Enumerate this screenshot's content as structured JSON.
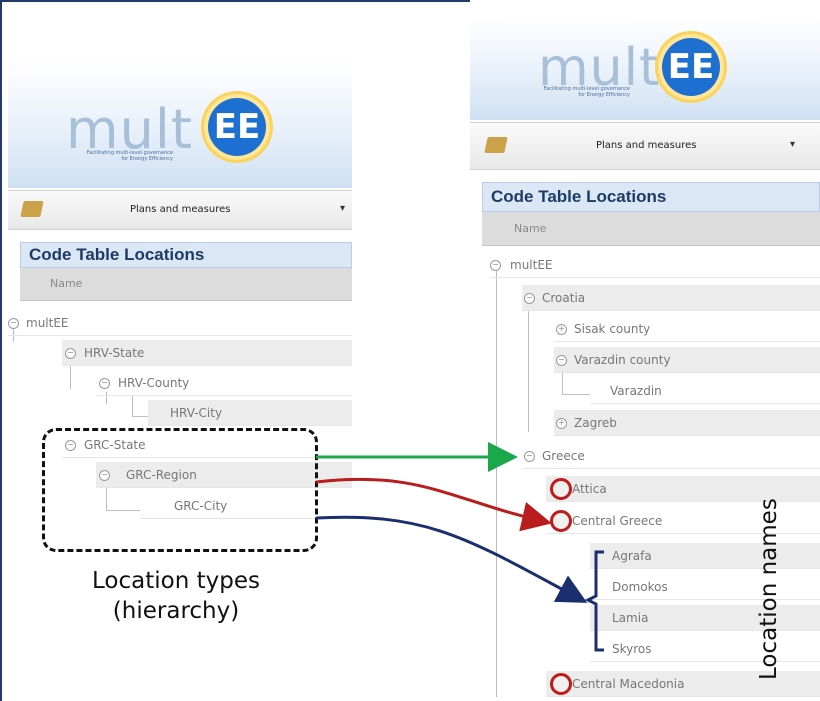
{
  "logo": {
    "word": "mult",
    "ee": "EE",
    "tagline_line1": "Facilitating multi-level governance",
    "tagline_line2": "for Energy Efficiency"
  },
  "toolbar": {
    "menu_label": "Plans and measures",
    "caret": "▾"
  },
  "left_panel": {
    "title": "Code Table Locations",
    "column_header": "Name",
    "tree": {
      "root": "multEE",
      "n1": "HRV-State",
      "n2": "HRV-County",
      "n3": "HRV-City",
      "n4": "GRC-State",
      "n5": "GRC-Region",
      "n6": "GRC-City"
    }
  },
  "right_panel": {
    "title": "Code Table Locations",
    "column_header": "Name",
    "tree": {
      "root": "multEE",
      "croatia": "Croatia",
      "sisak": "Sisak county",
      "varazdin_county": "Varazdin county",
      "varazdin": "Varazdin",
      "zagreb": "Zagreb",
      "greece": "Greece",
      "attica": "Attica",
      "central_greece": "Central Greece",
      "agrafa": "Agrafa",
      "domokos": "Domokos",
      "lamia": "Lamia",
      "skyros": "Skyros",
      "central_macedonia": "Central Macedonia"
    }
  },
  "annotations": {
    "location_types_line1": "Location types",
    "location_types_line2": "(hierarchy)",
    "location_names": "Location names"
  },
  "colors": {
    "green_arrow": "#1aa84a",
    "red_arrow": "#b81c1c",
    "blue_arrow": "#1b2f6e",
    "circle_mark": "#c01a1a"
  },
  "icons": [
    "edit-note-icon",
    "caret-down-icon",
    "expand-toggle-icon",
    "collapse-toggle-icon"
  ]
}
